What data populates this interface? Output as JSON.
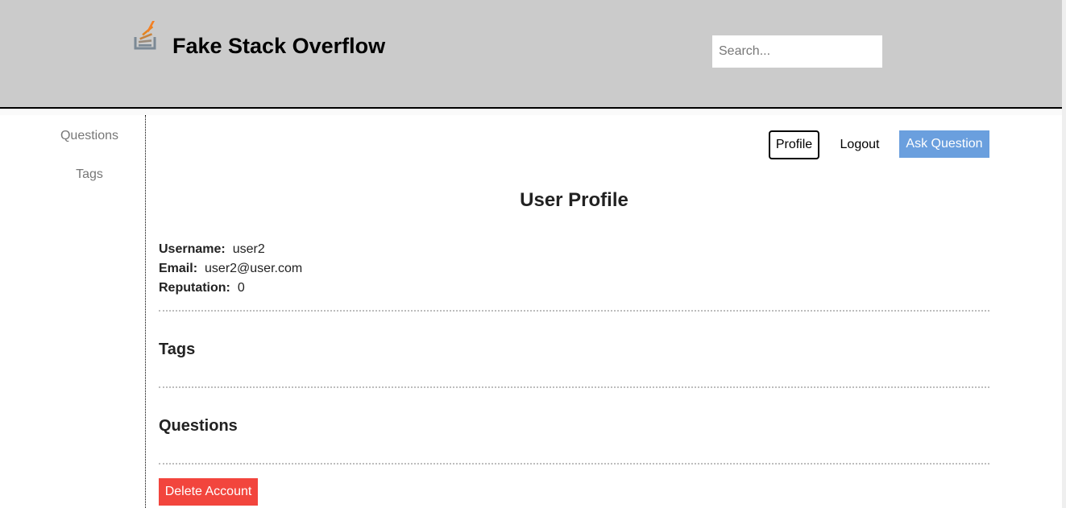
{
  "header": {
    "title": "Fake Stack Overflow",
    "search_placeholder": "Search..."
  },
  "sidebar": {
    "items": [
      {
        "label": "Questions"
      },
      {
        "label": "Tags"
      }
    ]
  },
  "toolbar": {
    "profile_label": "Profile",
    "logout_label": "Logout",
    "ask_label": "Ask Question"
  },
  "profile": {
    "title": "User Profile",
    "username_label": "Username:",
    "username": "user2",
    "email_label": "Email:",
    "email": "user2@user.com",
    "reputation_label": "Reputation:",
    "reputation": "0"
  },
  "sections": {
    "tags_title": "Tags",
    "questions_title": "Questions"
  },
  "actions": {
    "delete_label": "Delete Account"
  },
  "colors": {
    "header_bg": "#cbcbcb",
    "ask_button": "#6a9fde",
    "delete_button": "#f2453d"
  }
}
